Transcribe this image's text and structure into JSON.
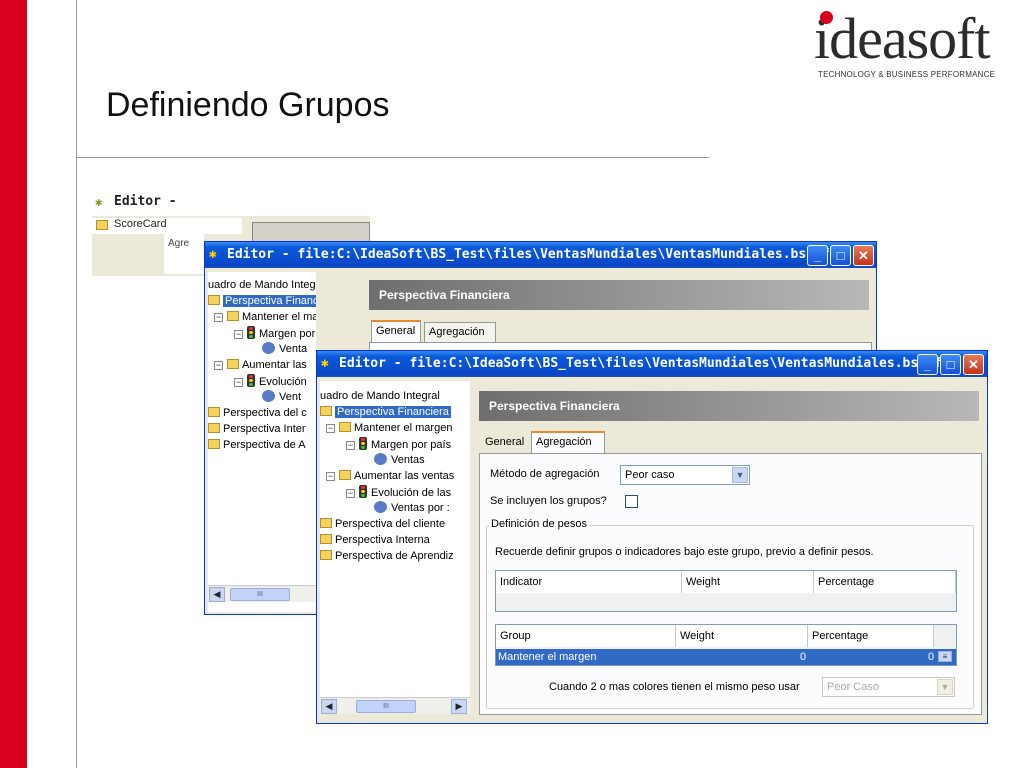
{
  "slide": {
    "title": "Definiendo Grupos",
    "logo_text": "ideasoft",
    "logo_tagline": "TECHNOLOGY & BUSINESS PERFORMANCE"
  },
  "bg_editor": {
    "title": "Editor -",
    "tree_item": "ScoreCard",
    "tab_fragment": "Agre"
  },
  "window_back": {
    "title": "Editor - file:C:\\IdeaSoft\\BS_Test\\files\\VentasMundiales\\VentasMundiales.bsDef",
    "panel_header": "Perspectiva Financiera",
    "tabs": [
      "General",
      "Agregación"
    ],
    "tree": [
      "uadro de Mando Integral",
      "Perspectiva Financiera",
      "Mantener el margen",
      "Margen por país",
      "Venta",
      "Aumentar las",
      "Evolución",
      "Vent",
      "Perspectiva del c",
      "Perspectiva Inter",
      "Perspectiva de A"
    ],
    "scroll_thumb": "III"
  },
  "window_front": {
    "title": "Editor - file:C:\\IdeaSoft\\BS_Test\\files\\VentasMundiales\\VentasMundiales.bsDef",
    "panel_header": "Perspectiva Financiera",
    "tabs": [
      "General",
      "Agregación"
    ],
    "tree": [
      "uadro de Mando Integral",
      "Perspectiva Financiera",
      "Mantener el margen",
      "Margen por país",
      "Ventas",
      "Aumentar las ventas",
      "Evolución de las",
      "Ventas por :",
      "Perspectiva del cliente",
      "Perspectiva Interna",
      "Perspectiva de Aprendiz"
    ],
    "scroll_thumb": "III",
    "form": {
      "metodo_label": "Método de agregación",
      "metodo_value": "Peor caso",
      "incluyen_label": "Se incluyen los grupos?",
      "incluyen_checked": false,
      "pesos_legend": "Definición de pesos",
      "pesos_note": "Recuerde definir grupos o indicadores bajo este grupo, previo a definir pesos.",
      "indicator_grid": {
        "columns": [
          "Indicator",
          "Weight",
          "Percentage"
        ]
      },
      "group_grid": {
        "columns": [
          "Group",
          "Weight",
          "Percentage"
        ],
        "rows": [
          {
            "group": "Mantener el margen",
            "weight": "0",
            "percentage": "0"
          }
        ]
      },
      "colores_label": "Cuando 2 o mas colores tienen el mismo peso usar",
      "colores_value": "Peor Caso"
    }
  },
  "colors": {
    "accent_red": "#d8001b",
    "xp_blue": "#0a4fd0",
    "selection": "#316ac5"
  }
}
